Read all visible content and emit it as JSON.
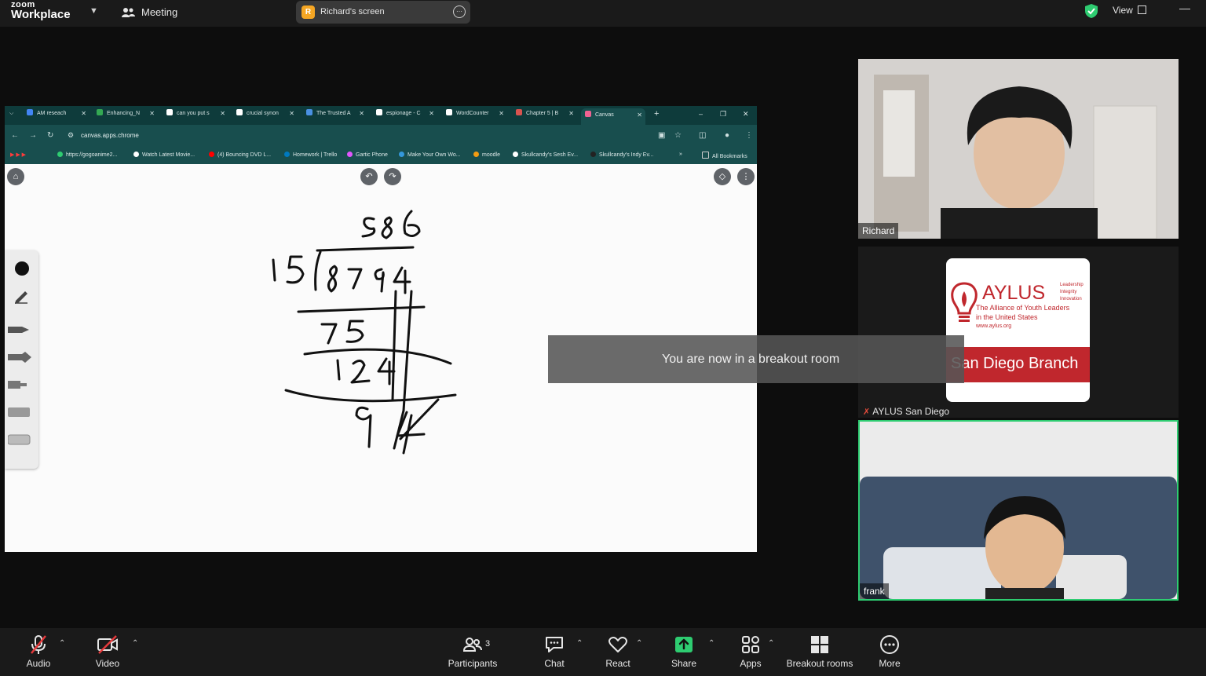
{
  "topbar": {
    "logo_small": "zoom",
    "logo_big": "Workplace",
    "meeting_label": "Meeting",
    "screen_avatar": "R",
    "screen_label": "Richard's screen",
    "view_label": "View"
  },
  "browser": {
    "tabs": [
      {
        "label": "AM reseach",
        "color": "#4285f4"
      },
      {
        "label": "Enhancing_N",
        "color": "#34a853"
      },
      {
        "label": "can you put s",
        "color": "#ffffff"
      },
      {
        "label": "crucial synon",
        "color": "#ffffff"
      },
      {
        "label": "The Trusted A",
        "color": "#4a90e2"
      },
      {
        "label": "espionage - C",
        "color": "#ffffff"
      },
      {
        "label": "WordCounter",
        "color": "#ffffff"
      },
      {
        "label": "Chapter 5 | B",
        "color": "#d9534f"
      },
      {
        "label": "Canvas",
        "color": "#f06292"
      }
    ],
    "url": "canvas.apps.chrome",
    "bookmarks": [
      {
        "label": "https://gogoanime2...",
        "color": "#2ecc71"
      },
      {
        "label": "Watch Latest Movie...",
        "color": "#ffffff"
      },
      {
        "label": "(4) Bouncing DVD L...",
        "color": "#ff0000"
      },
      {
        "label": "Homework | Trello",
        "color": "#0079bf"
      },
      {
        "label": "Gartic Phone",
        "color": "#e056fd"
      },
      {
        "label": "Make Your Own Wo...",
        "color": "#3498db"
      },
      {
        "label": "moodle",
        "color": "#f39c12"
      },
      {
        "label": "Skullcandy's Sesh Ev...",
        "color": "#ffffff"
      },
      {
        "label": "Skullcandy's Indy Ev...",
        "color": "#222222"
      }
    ],
    "all_bookmarks": "All Bookmarks"
  },
  "participants": {
    "richard": "Richard",
    "aylus": "AYLUS San Diego",
    "frank": "frank",
    "aylus_card": {
      "title": "AYLUS",
      "tag1": "Leadership",
      "tag2": "Integrity",
      "tag3": "Innovation",
      "line1": "The Alliance of Youth Leaders",
      "line2": "in the United States",
      "url": "www.aylus.org",
      "branch": "San Diego Branch"
    }
  },
  "toast": "You are now in a breakout room",
  "toolbar": {
    "audio": "Audio",
    "video": "Video",
    "participants": "Participants",
    "participants_count": "3",
    "chat": "Chat",
    "react": "React",
    "share": "Share",
    "apps": "Apps",
    "breakout": "Breakout rooms",
    "more": "More"
  },
  "colors": {
    "accent_green": "#2ecc71",
    "browser_teal": "#184e4e",
    "aylus_red": "#c0272d"
  }
}
